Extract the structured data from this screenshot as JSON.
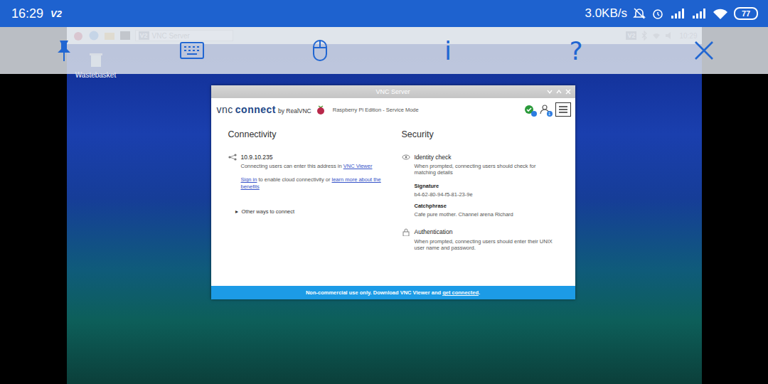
{
  "status_bar": {
    "time": "16:29",
    "app_badge": "V2",
    "net_speed": "3.0KB/s",
    "battery": "77"
  },
  "viewer_toolbar": {
    "info": "i",
    "help": "?"
  },
  "taskbar": {
    "task": {
      "badge": "V2",
      "label": "VNC Server"
    },
    "tray_badge": "V2",
    "clock": "10:29"
  },
  "desktop_icons": [
    {
      "label": "Wastebasket"
    }
  ],
  "window": {
    "title": "VNC Server",
    "brand": {
      "light": "vnc",
      "bold": "connect",
      "by": "by RealVNC"
    },
    "edition": "Raspberry Pi Edition - Service Mode",
    "users_badge": "1",
    "connectivity": {
      "heading": "Connectivity",
      "address": "10.9.10.235",
      "address_help": "Connecting users can enter this address in ",
      "address_link": "VNC Viewer",
      "signin_link": "Sign in",
      "signin_text": " to enable cloud connectivity or ",
      "learn_link": "learn more about the benefits",
      "other_ways": {
        "arrow": "▸",
        "label": "Other ways to connect",
        "expanded": false
      }
    },
    "security": {
      "heading": "Security",
      "identity": {
        "title": "Identity check",
        "text": "When prompted, connecting users should check for matching details"
      },
      "signature": {
        "label": "Signature",
        "value": "b4-62-80-94-f5-81-23-9e"
      },
      "catchphrase": {
        "label": "Catchphrase",
        "value": "Cafe pure mother. Channel arena Richard"
      },
      "authentication": {
        "title": "Authentication",
        "text": "When prompted, connecting users should enter their UNIX user name and password."
      }
    },
    "footer": {
      "text": "Non-commercial use only. Download VNC Viewer and ",
      "link": "get connected",
      "end": "."
    }
  }
}
